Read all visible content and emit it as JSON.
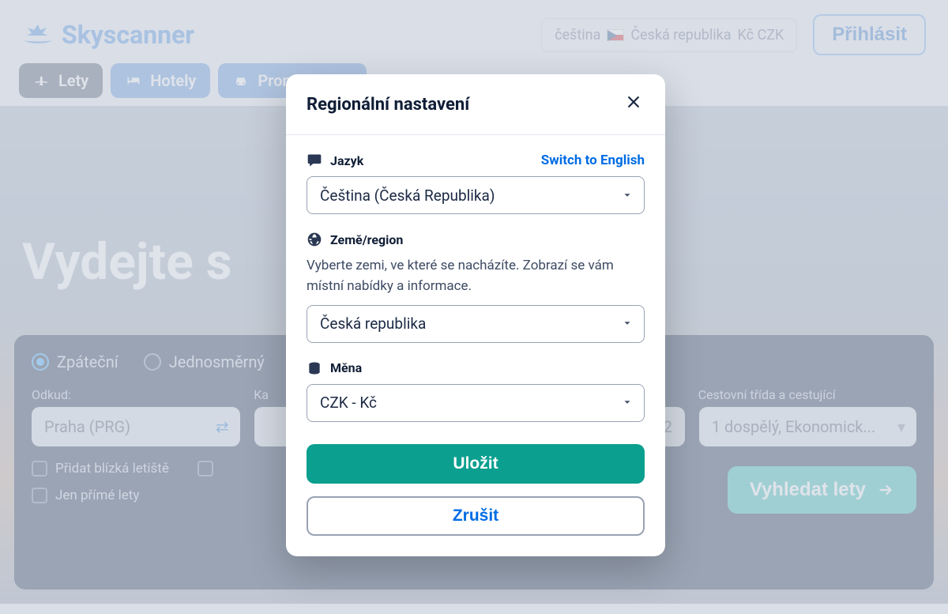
{
  "header": {
    "brand": "Skyscanner",
    "locale": {
      "language": "čeština",
      "country": "Česká republika",
      "currency": "Kč CZK"
    },
    "login": "Přihlásit"
  },
  "nav": {
    "flights": "Lety",
    "hotels": "Hotely",
    "cars": "Pronájem aut"
  },
  "hero": {
    "title": "Vydejte s"
  },
  "search": {
    "trip": {
      "return": "Zpáteční",
      "oneway": "Jednosměrný"
    },
    "labels": {
      "from": "Odkud:",
      "to": "Ka",
      "travelers": "Cestovní třída a cestující"
    },
    "values": {
      "from": "Praha (PRG)",
      "date_partial": "2",
      "travelers": "1 dospělý, Ekonomick..."
    },
    "checks": {
      "nearby": "Přidat blízká letiště",
      "direct": "Jen přímé lety"
    },
    "cta": "Vyhledat lety"
  },
  "modal": {
    "title": "Regionální nastavení",
    "language": {
      "label": "Jazyk",
      "switch": "Switch to English",
      "value": "Čeština (Česká Republika)"
    },
    "region": {
      "label": "Země/region",
      "hint": "Vyberte zemi, ve které se nacházíte. Zobrazí se vám místní nabídky a informace.",
      "value": "Česká republika"
    },
    "currency": {
      "label": "Měna",
      "value": "CZK - Kč"
    },
    "save": "Uložit",
    "cancel": "Zrušit"
  }
}
